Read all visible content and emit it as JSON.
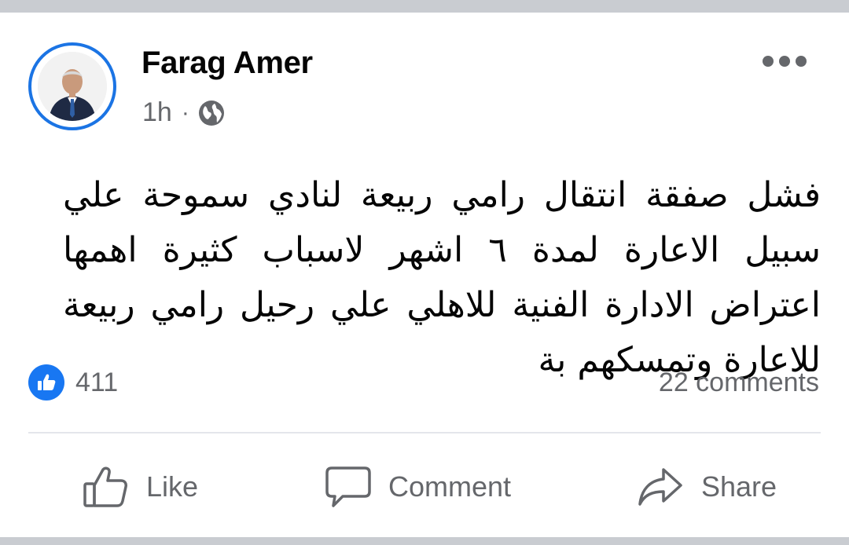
{
  "post": {
    "author": "Farag Amer",
    "time": "1h",
    "separator": "·",
    "privacy_icon": "globe-icon",
    "text": "فشل صفقة انتقال رامي ربيعة لنادي سموحة علي سبيل الاعارة لمدة ٦ اشهر لاسباب كثيرة اهمها اعتراض الادارة الفنية للاهلي علي رحيل رامي ربيعة للاعارة وتمسكهم بة"
  },
  "stats": {
    "reaction_icon": "like-reaction-icon",
    "reaction_count": "411",
    "comments": "22 comments"
  },
  "actions": {
    "like": "Like",
    "comment": "Comment",
    "share": "Share"
  },
  "colors": {
    "accent": "#1877f2",
    "muted_text": "#65676b",
    "text": "#050505",
    "background": "#ffffff",
    "page_background": "#c9ccd1"
  }
}
